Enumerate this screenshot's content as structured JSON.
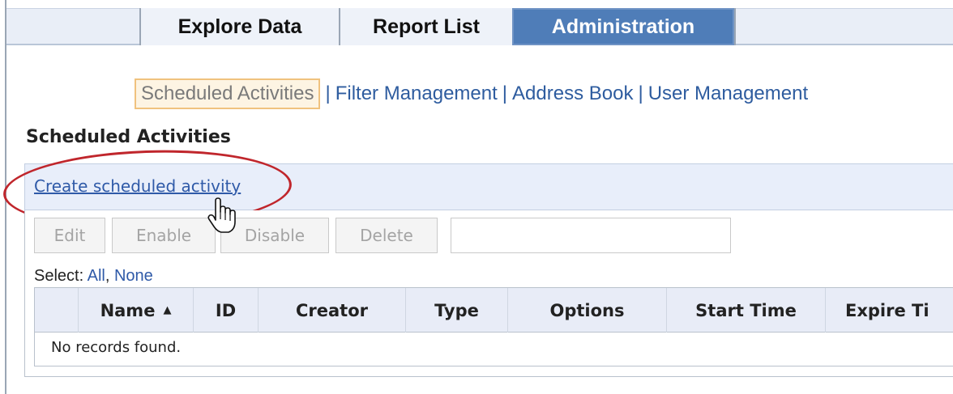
{
  "tabs": [
    {
      "label": "Explore Data",
      "active": false
    },
    {
      "label": "Report List",
      "active": false
    },
    {
      "label": "Administration",
      "active": true
    }
  ],
  "subnav": {
    "current": "Scheduled Activities",
    "separator": "|",
    "links": [
      "Filter Management",
      "Address Book",
      "User Management"
    ]
  },
  "section_title": "Scheduled Activities",
  "create_link": "Create scheduled activity",
  "buttons": {
    "edit": "Edit",
    "enable": "Enable",
    "disable": "Disable",
    "delete": "Delete"
  },
  "filter": {
    "value": ""
  },
  "select": {
    "label": "Select:",
    "all": "All",
    "separator": ",",
    "none": "None"
  },
  "grid": {
    "columns": [
      "Name",
      "ID",
      "Creator",
      "Type",
      "Options",
      "Start Time",
      "Expire Ti"
    ],
    "sorted_column": "Name",
    "sort_indicator": "▲",
    "empty_message": "No records found."
  },
  "colors": {
    "active_tab": "#4f7db8",
    "link": "#2f5aa8",
    "highlight": "#c0262c",
    "current_subnav_border": "#f0c27e"
  },
  "icons": {
    "cursor": "hand-pointer-icon",
    "highlight": "red-ellipse-annotation"
  }
}
